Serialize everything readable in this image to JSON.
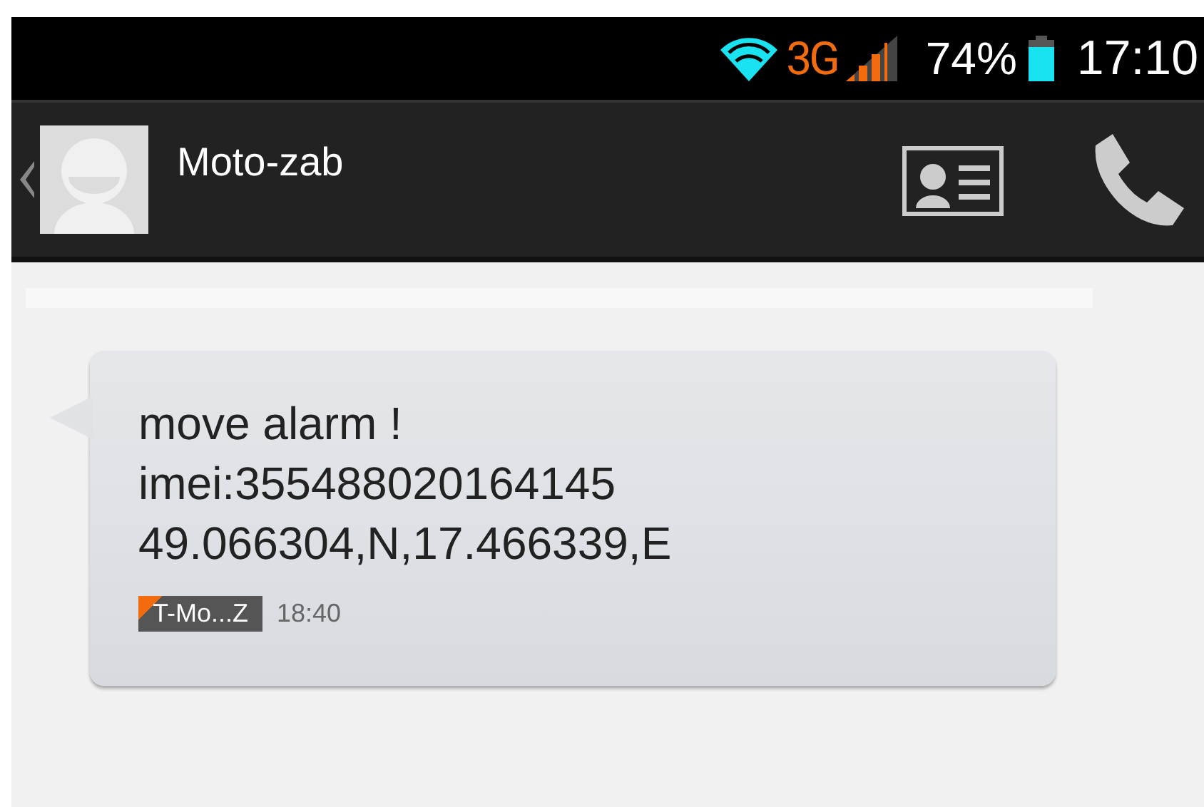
{
  "status_bar": {
    "network": "3G",
    "battery": "74%",
    "time": "17:10"
  },
  "action_bar": {
    "contact_name": "Moto-zab"
  },
  "messages": [
    {
      "lines": [
        "move alarm !",
        "imei:355488020164145",
        "49.066304,N,17.466339,E"
      ],
      "sim": "T-Mo...Z",
      "time": "18:40"
    }
  ]
}
